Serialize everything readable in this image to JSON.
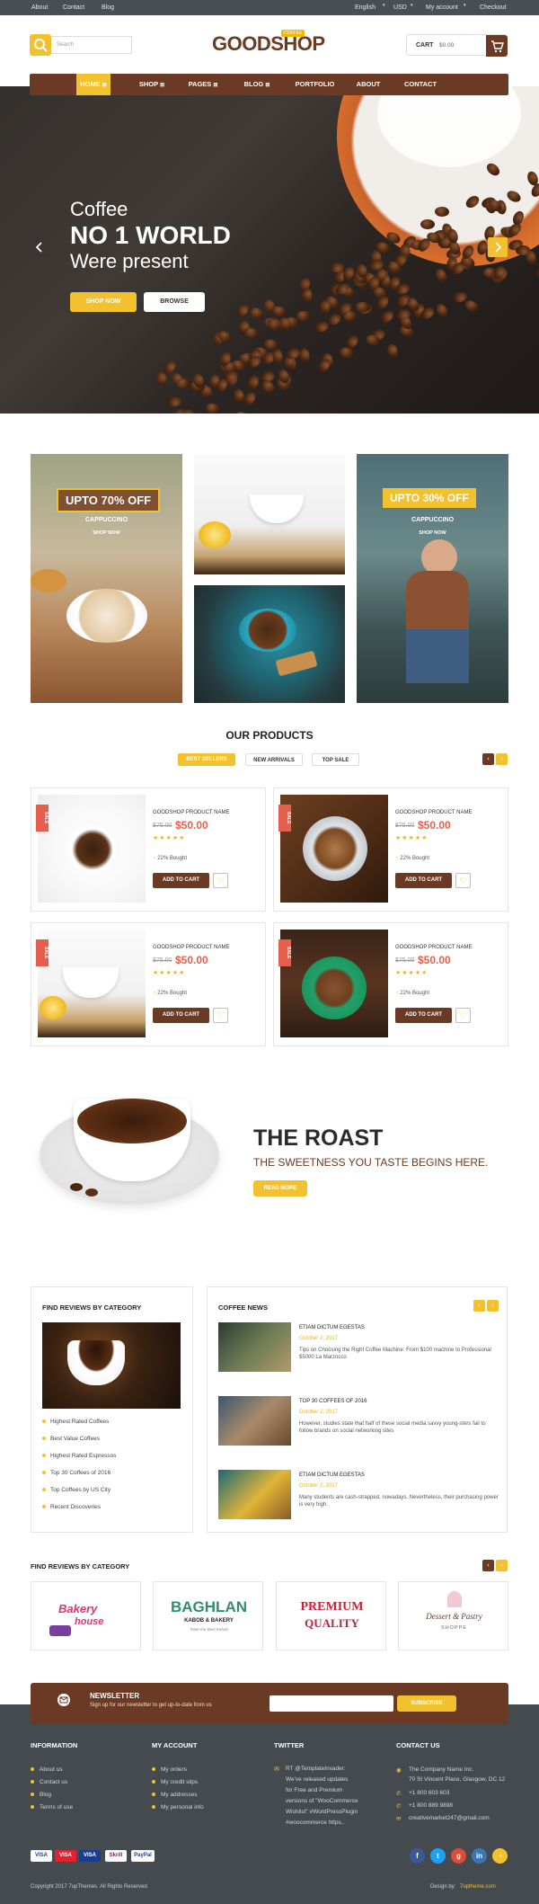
{
  "topbar": {
    "about": "About",
    "contact": "Contact",
    "blog": "Blog",
    "language": "English",
    "currency": "USD",
    "account": "My account",
    "checkout": "Checkout"
  },
  "header": {
    "search_placeholder": "Search",
    "logo": "GOODSHOP",
    "logo_tag": "COFFEE",
    "cart_label": "CART",
    "cart_total": "$0.00"
  },
  "nav": {
    "home": "HOME",
    "shop": "SHOP",
    "pages": "PAGES",
    "blog": "BLOG",
    "portfolio": "PORTFOLIO",
    "about": "ABOUT",
    "contact": "CONTACT"
  },
  "hero": {
    "line1": "Coffee",
    "line2": "NO 1 WORLD",
    "line3": "Were present",
    "shop_now": "SHOP NOW",
    "browse": "BROWSE"
  },
  "promos": {
    "left": {
      "badge": "UPTO 70% OFF",
      "title": "CAPPUCCINO",
      "link": "SHOP NOW"
    },
    "right": {
      "badge": "UPTO 30% OFF",
      "title": "CAPPUCCINO",
      "link": "SHOP NOW"
    }
  },
  "products": {
    "title": "OUR PRODUCTS",
    "tabs": [
      "BEST SELLERS",
      "NEW ARRIVALS",
      "TOP SALE"
    ],
    "items": [
      {
        "name": "GOODSHOP PRODUCT NAME",
        "old": "$75.00",
        "price": "$50.00",
        "bought": "22% Bought",
        "cart": "ADD TO CART",
        "sale": "SALE"
      },
      {
        "name": "GOODSHOP PRODUCT NAME",
        "old": "$75.00",
        "price": "$50.00",
        "bought": "22% Bought",
        "cart": "ADD TO CART",
        "sale": "SALE"
      },
      {
        "name": "GOODSHOP PRODUCT NAME",
        "old": "$75.00",
        "price": "$50.00",
        "bought": "22% Bought",
        "cart": "ADD TO CART",
        "sale": "SALE"
      },
      {
        "name": "GOODSHOP PRODUCT NAME",
        "old": "$75.00",
        "price": "$50.00",
        "bought": "22% Bought",
        "cart": "ADD TO CART",
        "sale": "SALE"
      }
    ]
  },
  "roast": {
    "title": "THE ROAST",
    "subtitle": "THE SWEETNESS YOU TASTE BEGINS HERE.",
    "button": "READ MORE"
  },
  "reviews": {
    "title": "FIND REVIEWS BY CATEGORY",
    "items": [
      "Highest Rated Coffees",
      "Best Value Coffees",
      "Highest Rated Espressos",
      "Top 30 Coffees of 2016",
      "Top Coffees by US City",
      "Recent Discoveries"
    ]
  },
  "news": {
    "title": "COFFEE NEWS",
    "items": [
      {
        "title": "ETIAM DICTUM EGESTAS",
        "date": "October 2, 2017",
        "text": "Tips on Choosing the Right Coffee Machine: From $100 machine to Professional $5000 La Marzocco"
      },
      {
        "title": "TOP 30 COFFEES OF 2016",
        "date": "October 2, 2017",
        "text": "However, studies state that half of these social media savvy young-sters fail to follow brands on social networking sites"
      },
      {
        "title": "ETIAM DICTUM EGESTAS",
        "date": "October 2, 2017",
        "text": "Many students are cash-strapped, nowadays. Nevertheless, their purchasing power is very high."
      }
    ]
  },
  "brands": {
    "title": "FIND REVIEWS BY CATEGORY",
    "b1a": "Bakery",
    "b1b": "house",
    "b2a": "BAGHLAN",
    "b2b": "KABOB & BAKERY",
    "b2c": "Taste the Best Kebab",
    "b3a": "PREMIUM",
    "b3b": "QUALITY",
    "b4a": "Dessert & Pastry",
    "b4b": "SHOPPE"
  },
  "newsletter": {
    "title": "NEWSLETTER",
    "text": "Sign up for our newsletter to get up-to-date from us",
    "button": "SUBSCRIBE"
  },
  "footer": {
    "info_title": "INFORMATION",
    "info": [
      "About us",
      "Contact us",
      "Blog",
      "Terms of use"
    ],
    "account_title": "MY ACCOUNT",
    "account": [
      "My orders",
      "My credit slips",
      "My addresses",
      "My personal info"
    ],
    "twitter_title": "TWITTER",
    "tweet1": "RT @TemplateInvader:",
    "tweet2": "We've released updates",
    "tweet3": "for Free and Premium",
    "tweet4": "versions of \"WooCommerce",
    "tweet5": "Wishlist\" #WordPressPlugin",
    "tweet6": "#woocommerce https..",
    "contact_title": "CONTACT US",
    "address1": "The Company Name Inc.",
    "address2": "70 St Vincent Place, Glasgow, DC 12",
    "phone1": "+1 800 603 603",
    "phone2": "+1 800 889 9898",
    "email": "creativemarket247@gmail.com",
    "payments": [
      "VISA",
      "VISA",
      "VISA",
      "Skrill",
      "PayPal"
    ],
    "copyright": "Copyright 2017 7upThemes. All Rights Reserved.",
    "design_prefix": "Design by:",
    "design_by": "7uptheme.com"
  },
  "colors": {
    "accent": "#f2c12e",
    "brown": "#6b3a24",
    "sale": "#e55e4e",
    "footer": "#454a4e"
  }
}
